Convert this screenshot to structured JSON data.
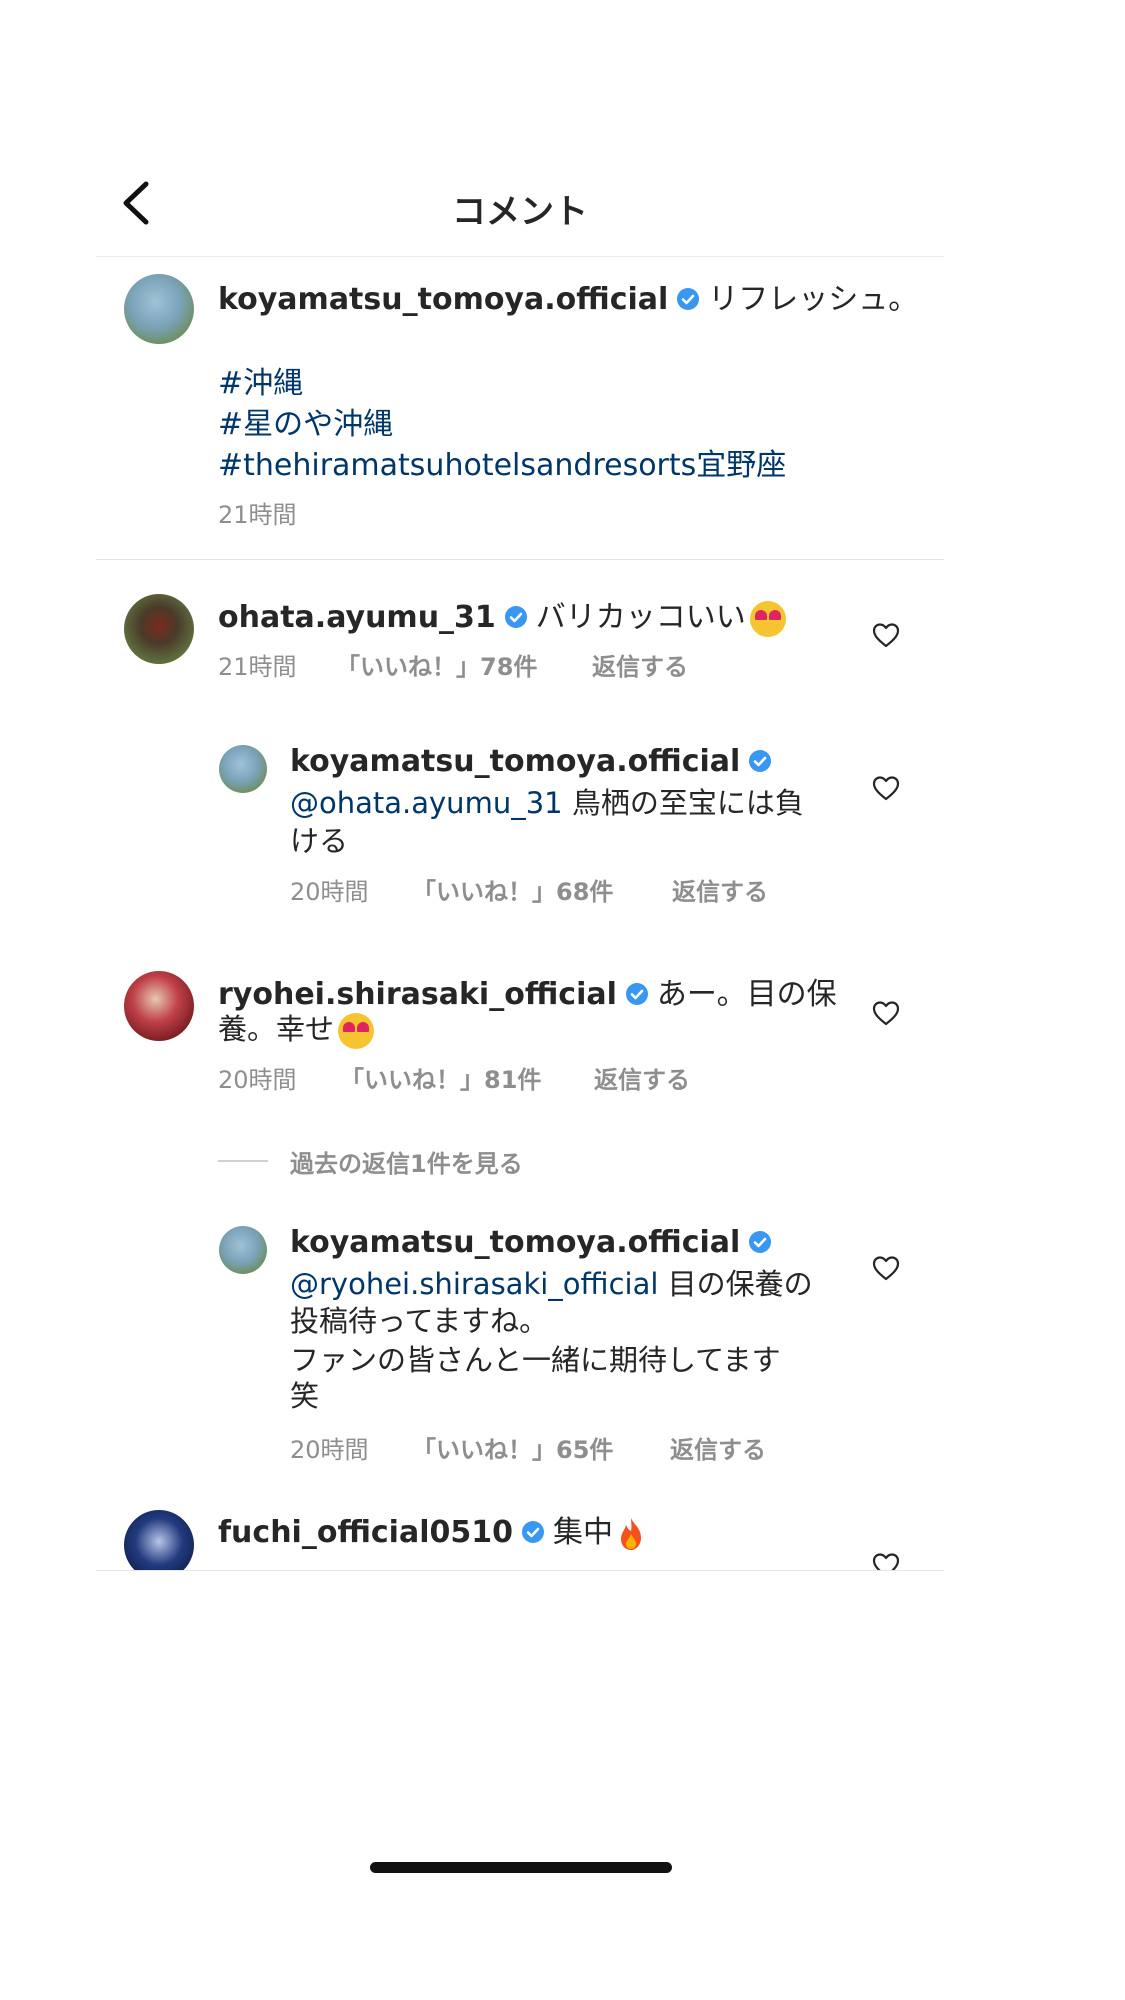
{
  "header": {
    "title": "コメント",
    "back_icon": "chevron-left-icon"
  },
  "caption": {
    "username": "koyamatsu_tomoya.official",
    "text": "リフレッシュ。",
    "hashtags": [
      "#沖縄",
      "#星のや沖縄",
      "#thehiramatsuhotelsandresorts宜野座"
    ],
    "time": "21時間"
  },
  "comments": [
    {
      "username": "ohata.ayumu_31",
      "text": "バリカッコいい",
      "emoji": "smiling-face-with-heart-eyes",
      "time": "21時間",
      "likes": "「いいね！」78件",
      "reply_label": "返信する"
    },
    {
      "username": "koyamatsu_tomoya.official",
      "mention": "@ohata.ayumu_31",
      "text_line1": " 鳥栖の至宝には負",
      "text_line2": "ける",
      "time": "20時間",
      "likes": "「いいね！」68件",
      "reply_label": "返信する"
    },
    {
      "username": "ryohei.shirasaki_official",
      "text_line1": "あー。目の保",
      "text_line2": "養。幸せ",
      "emoji": "smiling-face-with-heart-eyes",
      "time": "20時間",
      "likes": "「いいね！」81件",
      "reply_label": "返信する",
      "view_replies": "過去の返信1件を見る"
    },
    {
      "username": "koyamatsu_tomoya.official",
      "mention": "@ryohei.shirasaki_official",
      "text_line1": " 目の保養の",
      "text_line2": "投稿待ってますね。",
      "text_line3": "ファンの皆さんと一緒に期待してます",
      "text_line4": "笑",
      "time": "20時間",
      "likes": "「いいね！」65件",
      "reply_label": "返信する"
    },
    {
      "username": "fuchi_official0510",
      "text": "集中",
      "emoji": "fire"
    }
  ],
  "colors": {
    "link": "#00376b",
    "verified": "#3897f0",
    "meta": "#8e8e8e",
    "text": "#262626"
  }
}
